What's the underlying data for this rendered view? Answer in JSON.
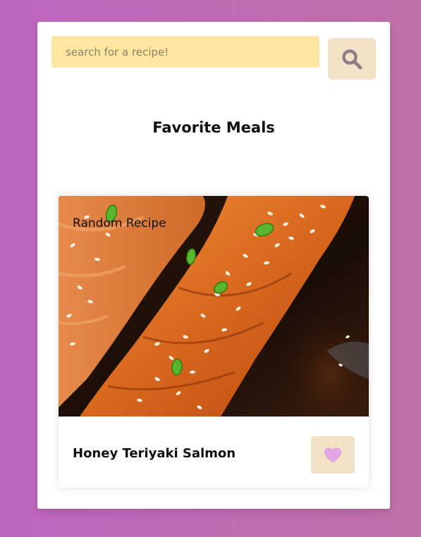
{
  "search": {
    "placeholder": "search for a recipe!",
    "value": "",
    "button_icon": "search-icon"
  },
  "favorites": {
    "title": "Favorite Meals"
  },
  "meal": {
    "tag": "Random Recipe",
    "name": "Honey Teriyaki Salmon",
    "favorite_icon": "heart-icon"
  },
  "colors": {
    "background_start": "#bd66c1",
    "background_end": "#c070a8",
    "search_input_bg": "#fde69f",
    "button_bg": "#f2e2c6",
    "search_icon": "#8d7f86",
    "heart_icon": "#e3a5e3"
  }
}
